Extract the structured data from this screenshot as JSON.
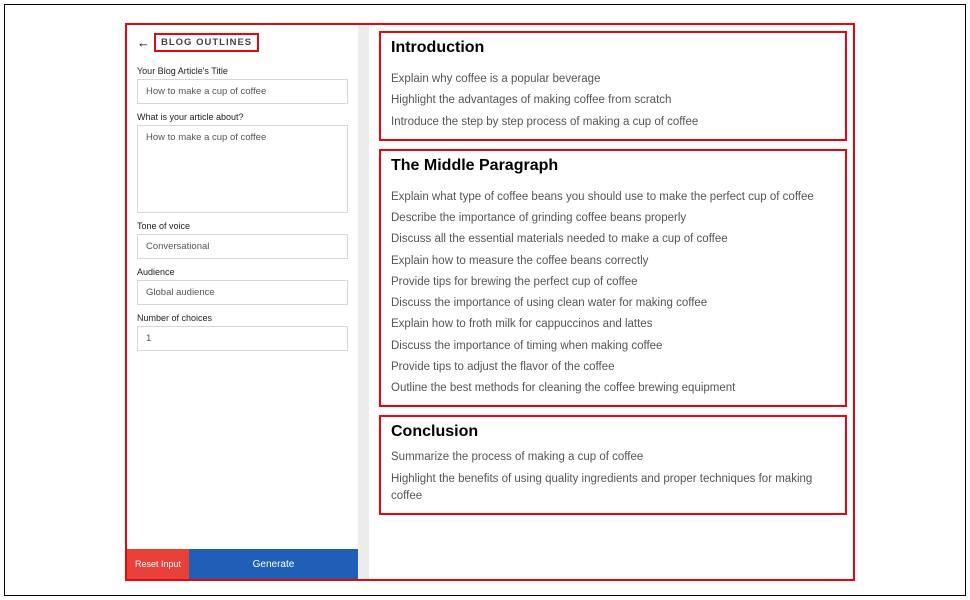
{
  "header": {
    "back_icon": "←",
    "page_badge": "BLOG OUTLINES"
  },
  "form": {
    "title_label": "Your Blog Article's Title",
    "title_value": "How to make a cup of coffee",
    "about_label": "What is your article about?",
    "about_value": "How to make a cup of coffee",
    "tone_label": "Tone of voice",
    "tone_value": "Conversational",
    "audience_label": "Audience",
    "audience_value": "Global audience",
    "choices_label": "Number of choices",
    "choices_value": "1"
  },
  "buttons": {
    "reset": "Reset Input",
    "generate": "Generate"
  },
  "outline": {
    "intro": {
      "title": "Introduction",
      "items": [
        "Explain why coffee is a popular beverage",
        "Highlight the advantages of making coffee from scratch",
        "Introduce the step by step process of making a cup of coffee"
      ]
    },
    "middle": {
      "title": "The Middle Paragraph",
      "items": [
        "Explain what type of coffee beans you should use to make the perfect cup of coffee",
        "Describe the importance of grinding coffee beans properly",
        "Discuss all the essential materials needed to make a cup of coffee",
        "Explain how to measure the coffee beans correctly",
        "Provide tips for brewing the perfect cup of coffee",
        "Discuss the importance of using clean water for making coffee",
        "Explain how to froth milk for cappuccinos and lattes",
        "Discuss the importance of timing when making coffee",
        "Provide tips to adjust the flavor of the coffee",
        "Outline the best methods for cleaning the coffee brewing equipment"
      ]
    },
    "conclusion": {
      "title": "Conclusion",
      "items": [
        "Summarize the process of making a cup of coffee",
        "Highlight the benefits of using quality ingredients and proper techniques for making coffee"
      ]
    }
  }
}
